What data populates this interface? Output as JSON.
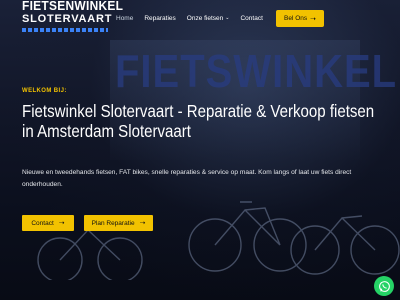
{
  "header": {
    "logo_top": "FIETSENWINKEL",
    "logo_bottom": "SLOTERVAART",
    "nav": [
      {
        "label": "Home"
      },
      {
        "label": "Reparaties"
      },
      {
        "label": "Onze fietsen"
      },
      {
        "label": "Contact"
      }
    ],
    "call_label": "Bel Ons"
  },
  "background": {
    "sign_text": "FIETSWINKEL"
  },
  "hero": {
    "eyebrow": "WELKOM BIJ:",
    "headline": "Fietswinkel Slotervaart - Reparatie & Verkoop fietsen in Amsterdam Slotervaart",
    "intro": "Nieuwe en tweedehands fietsen, FAT bikes, snelle reparaties & service op maat. Kom langs of laat uw fiets direct onderhouden.",
    "btn_contact": "Contact",
    "btn_plan": "Plan Reparatie"
  },
  "icons": {
    "arrow": "arrow-right-icon",
    "chevron": "chevron-down-icon",
    "whatsapp": "whatsapp-icon"
  },
  "colors": {
    "accent": "#f2c200",
    "background": "#0a0e1a",
    "whatsapp": "#25d366"
  }
}
